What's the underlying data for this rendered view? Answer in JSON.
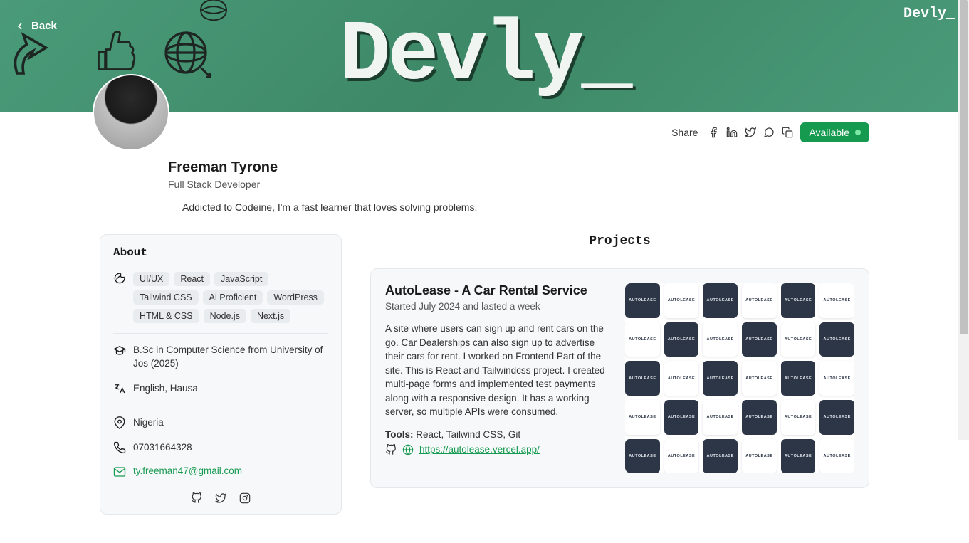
{
  "hero": {
    "title": "Devly_",
    "brand_corner": "Devly_",
    "back_label": "Back"
  },
  "share": {
    "label": "Share"
  },
  "status": {
    "label": "Available"
  },
  "profile": {
    "name": "Freeman Tyrone",
    "role": "Full Stack Developer",
    "bio": "Addicted to Codeine, I'm a fast learner that loves solving problems."
  },
  "about": {
    "heading": "About",
    "skills": [
      "UI/UX",
      "React",
      "JavaScript",
      "Tailwind CSS",
      "Ai Proficient",
      "WordPress",
      "HTML & CSS",
      "Node.js",
      "Next.js"
    ],
    "education": "B.Sc in Computer Science from University of Jos (2025)",
    "languages": "English, Hausa",
    "location": "Nigeria",
    "phone": "07031664328",
    "email": "ty.freeman47@gmail.com"
  },
  "projects": {
    "heading": "Projects",
    "items": [
      {
        "title": "AutoLease - A Car Rental Service",
        "dates": "Started July 2024 and lasted a week",
        "description": "A site where users can sign up and rent cars on the go. Car Dealerships can also sign up to advertise their cars for rent. I worked on Frontend Part of the site. This is React and Tailwindcss project. I created multi-page forms and implemented test payments along with a responsive design. It has a working server, so multiple APIs were consumed.",
        "tools_label": "Tools:",
        "tools": "React, Tailwind CSS, Git",
        "link": "https://autolease.vercel.app/",
        "thumb_text": "AUTOLEASE"
      }
    ]
  }
}
